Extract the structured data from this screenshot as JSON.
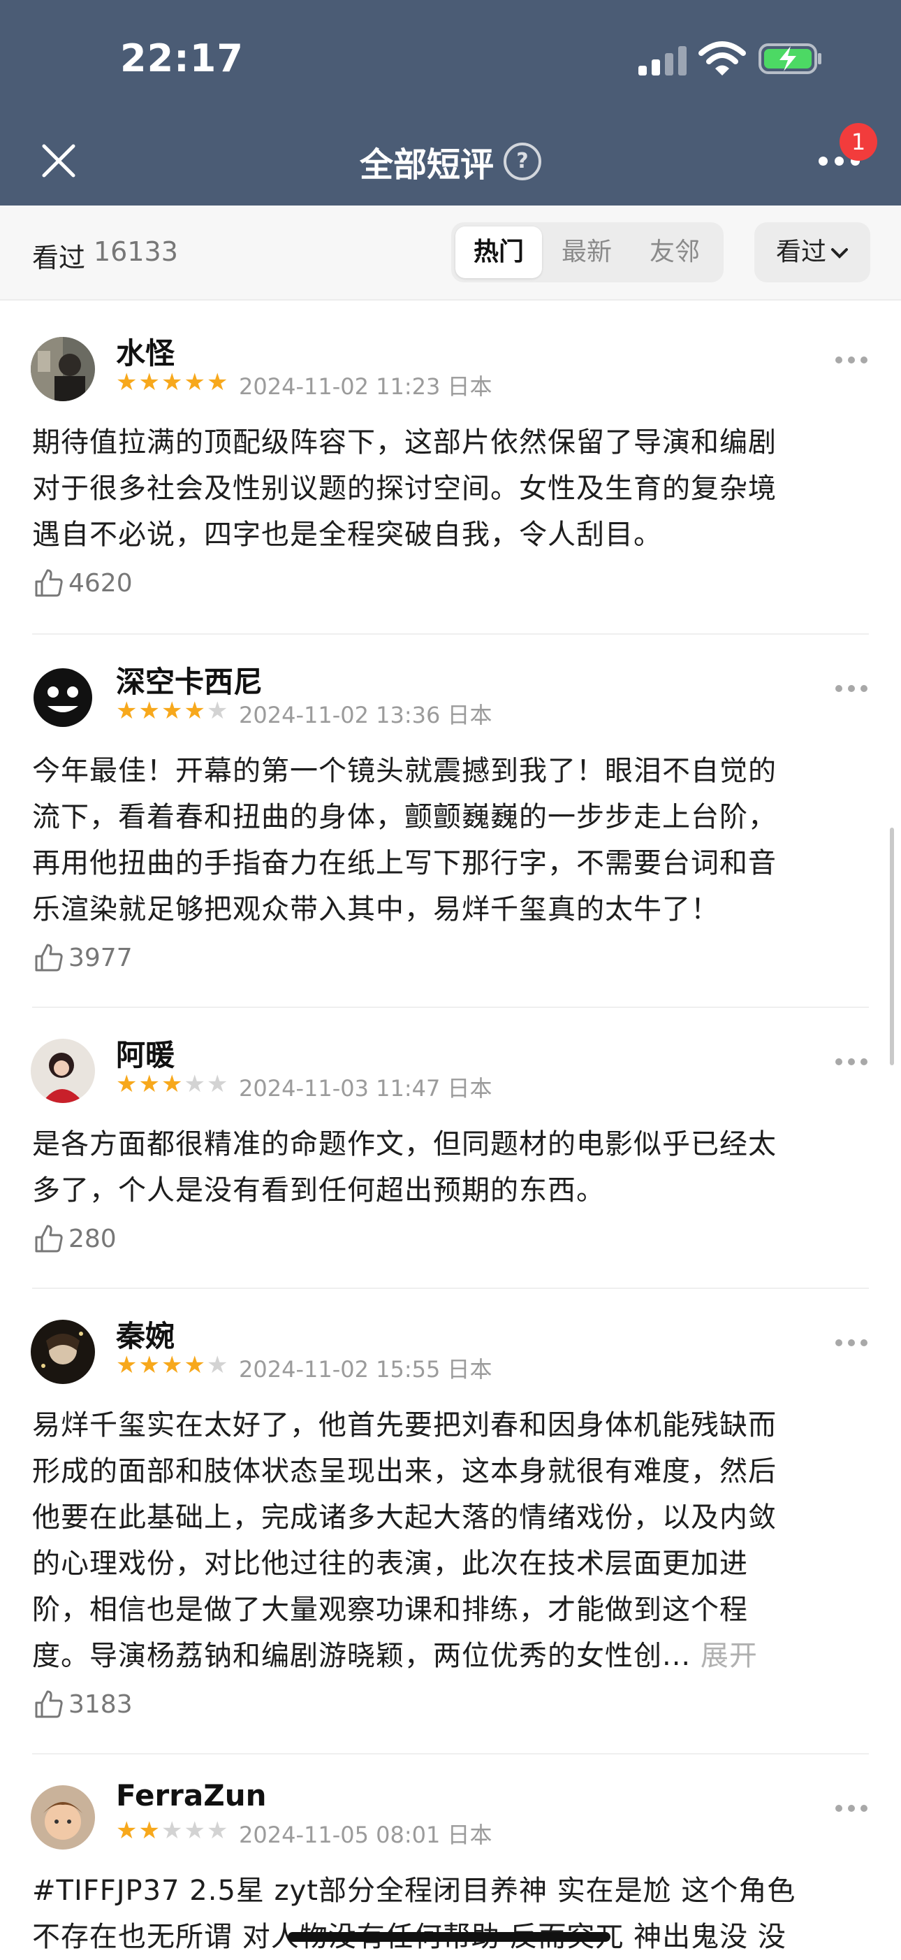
{
  "status_bar": {
    "time": "22:17"
  },
  "nav": {
    "title": "全部短评",
    "help_glyph": "?",
    "notification_count": "1"
  },
  "filter": {
    "seen_label": "看过",
    "seen_count": "16133",
    "tabs": [
      "热门",
      "最新",
      "友邻"
    ],
    "active_tab": "热门",
    "dropdown_label": "看过"
  },
  "reviews": [
    {
      "user": "水怪",
      "rating": 5,
      "date": "2024-11-02 11:23",
      "location": "日本",
      "lines": [
        "期待值拉满的顶配级阵容下，这部片依然保留了导演和编剧",
        "对于很多社会及性别议题的探讨空间。女性及生育的复杂境",
        "遇自不必说，四字也是全程突破自我，令人刮目。"
      ],
      "likes": "4620"
    },
    {
      "user": "深空卡西尼",
      "rating": 4,
      "date": "2024-11-02 13:36",
      "location": "日本",
      "lines": [
        "今年最佳！开幕的第一个镜头就震撼到我了！眼泪不自觉的",
        "流下，看着春和扭曲的身体，颤颤巍巍的一步步走上台阶，",
        "再用他扭曲的手指奋力在纸上写下那行字，不需要台词和音",
        "乐渲染就足够把观众带入其中，易烊千玺真的太牛了！"
      ],
      "likes": "3977"
    },
    {
      "user": "阿暖",
      "rating": 3,
      "date": "2024-11-03 11:47",
      "location": "日本",
      "lines": [
        "是各方面都很精准的命题作文，但同题材的电影似乎已经太",
        "多了，个人是没有看到任何超出预期的东西。"
      ],
      "likes": "280"
    },
    {
      "user": "秦婉",
      "rating": 4,
      "date": "2024-11-02 15:55",
      "location": "日本",
      "lines": [
        "易烊千玺实在太好了，他首先要把刘春和因身体机能残缺而",
        "形成的面部和肢体状态呈现出来，这本身就很有难度，然后",
        "他要在此基础上，完成诸多大起大落的情绪戏份，以及内敛",
        "的心理戏份，对比他过往的表演，此次在技术层面更加进",
        "阶，相信也是做了大量观察功课和排练，才能做到这个程",
        "度。导演杨荔钠和编剧游晓颖，两位优秀的女性创..."
      ],
      "expand": "展开",
      "likes": "3183"
    },
    {
      "user": "FerraZun",
      "rating": 2,
      "date": "2024-11-05 08:01",
      "location": "日本",
      "lines": [
        "#TIFFJP37 2.5星 zyt部分全程闭目养神 实在是尬 这个角色",
        "不存在也无所谓 对人物没有任何帮助 反而突兀 神出鬼没 没"
      ],
      "likes": ""
    }
  ]
}
